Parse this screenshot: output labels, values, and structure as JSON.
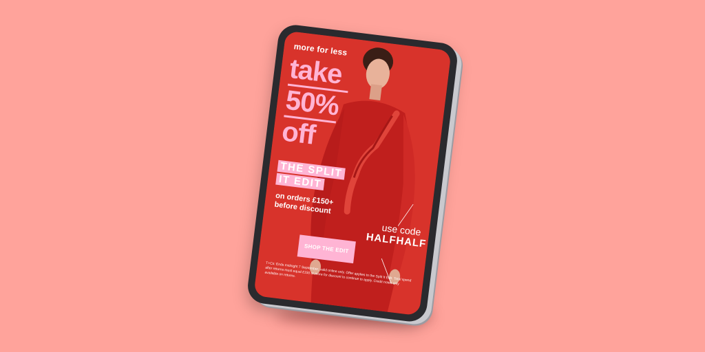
{
  "colors": {
    "background": "#ffa39b",
    "screen_red": "#d22d26",
    "accent_pink": "#ffb4d4",
    "text_white": "#ffffff",
    "device_frame": "#2a2a2e"
  },
  "ad": {
    "tagline": "more for less",
    "headline_lines": [
      "take",
      "50%",
      "off"
    ],
    "edit_lines": [
      "THE SPLIT",
      "IT EDIT"
    ],
    "condition_lines": [
      "on orders £150+",
      "before discount"
    ],
    "promo": {
      "use_label": "use code",
      "code": "HALFHALF"
    },
    "cta_label": "SHOP THE EDIT",
    "terms": "T+Cs: Ends midnight 7 September, valid online only. Offer applies to the Split It Edit. Total spend after returns must equal £150 or more for discount to continue to apply. Credit notes only available on returns."
  }
}
